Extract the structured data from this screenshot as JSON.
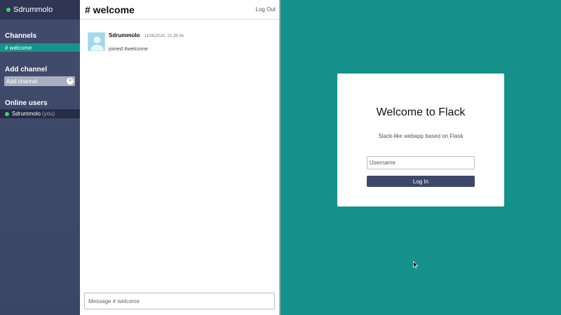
{
  "chat": {
    "sidebar": {
      "username": "Sdrummolo",
      "channels_title": "Channels",
      "channels": [
        {
          "label": "# welcome",
          "active": true
        }
      ],
      "add_channel_title": "Add channel",
      "add_channel_placeholder": "Add channel",
      "online_users_title": "Online users",
      "online_users": [
        {
          "name": "Sdrummolo",
          "suffix": "(you)"
        }
      ]
    },
    "header": {
      "title": "# welcome",
      "logout_label": "Log Out"
    },
    "messages": [
      {
        "author": "Sdrummolo",
        "timestamp": "11/05/2020, 21:26:34",
        "text": "joined #welcome"
      }
    ],
    "composer": {
      "placeholder": "Message # welcome"
    }
  },
  "login": {
    "title": "Welcome to Flack",
    "subtitle": "Slack-like webapp based on Flask",
    "username_placeholder": "Username",
    "login_label": "Log In"
  },
  "colors": {
    "sidebar_bg": "#3b4566",
    "sidebar_header_bg": "#2e3654",
    "active_channel": "#16948c",
    "online_status": "#3fd36a",
    "login_bg": "#14918a",
    "login_button": "#3d4769"
  },
  "icons": {
    "status": "online-status-dot",
    "add_channel": "plus-icon",
    "avatar": "user-avatar-icon",
    "cursor": "mouse-cursor-icon"
  }
}
